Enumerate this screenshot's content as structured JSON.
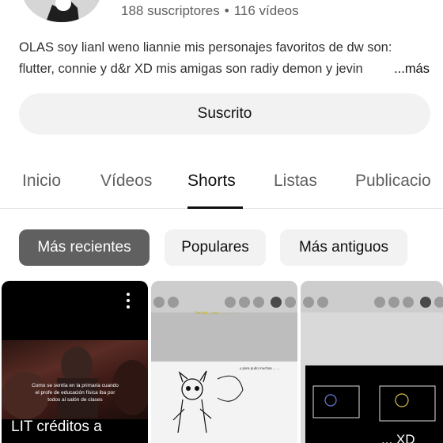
{
  "channel": {
    "subscribers": "188 suscriptores",
    "separator": "•",
    "videos": "116 vídeos",
    "description_line1": "OLAS soy lianl weno liannie mis personajes favoritos de dw son:",
    "description_line2": "flutter, connie y d&r XD mis amigas son radiy demon y jevin",
    "more_label": "...más",
    "subscribe_label": "Suscrito"
  },
  "tabs": [
    {
      "label": "Inicio",
      "active": false
    },
    {
      "label": "Vídeos",
      "active": false
    },
    {
      "label": "Shorts",
      "active": true
    },
    {
      "label": "Listas",
      "active": false
    },
    {
      "label": "Publicacio",
      "active": false
    }
  ],
  "filters": [
    {
      "label": "Más recientes",
      "active": true
    },
    {
      "label": "Populares",
      "active": false
    },
    {
      "label": "Más antiguos",
      "active": false
    }
  ],
  "shorts": [
    {
      "title": "LIT créditos a",
      "caption": "Como se sentía en la primaria cuando el profe de educación física iba por todos al salón de clases",
      "menu_icon": "more-vert-icon"
    },
    {
      "yellow_text": "fan-tui... en... ... ... ...",
      "hand_text": "y para pudo muchas ... ..."
    },
    {
      "caption": "... XD"
    }
  ],
  "colors": {
    "active_chip": "#606060",
    "chip": "#f2f2f2",
    "text_primary": "#0f0f0f",
    "text_secondary": "#606060"
  }
}
